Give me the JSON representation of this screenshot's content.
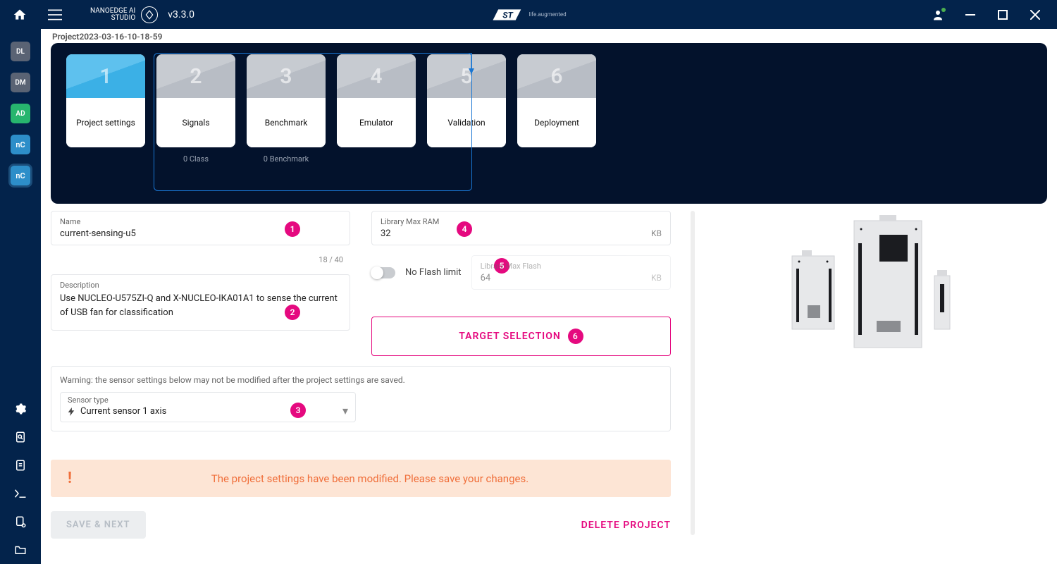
{
  "app": {
    "brand_top": "NANOEDGE AI",
    "brand_bot": "STUDIO",
    "version": "v3.3.0",
    "center_logo": "ST",
    "center_tag": "life.augmented"
  },
  "sidebar": {
    "items": [
      {
        "code": "DL"
      },
      {
        "code": "DM"
      },
      {
        "code": "AD"
      },
      {
        "code": "nC"
      },
      {
        "code": "nC"
      }
    ]
  },
  "project": {
    "name_header": "Project2023-03-16-10-18-59"
  },
  "steps": [
    {
      "num": "1",
      "label": "Project settings",
      "sub": "",
      "active": true
    },
    {
      "num": "2",
      "label": "Signals",
      "sub": "0 Class",
      "active": false
    },
    {
      "num": "3",
      "label": "Benchmark",
      "sub": "0 Benchmark",
      "active": false
    },
    {
      "num": "4",
      "label": "Emulator",
      "sub": "",
      "active": false
    },
    {
      "num": "5",
      "label": "Validation",
      "sub": "",
      "active": false
    },
    {
      "num": "6",
      "label": "Deployment",
      "sub": "",
      "active": false
    }
  ],
  "form": {
    "name_label": "Name",
    "name_value": "current-sensing-u5",
    "name_counter": "18 / 40",
    "desc_label": "Description",
    "desc_value": "Use NUCLEO-U575ZI-Q and X-NUCLEO-IKA01A1 to sense the current of USB fan for classification",
    "ram_label": "Library Max RAM",
    "ram_value": "32",
    "ram_unit": "KB",
    "flash_toggle_label": "No Flash limit",
    "flash_label": "Library Max Flash",
    "flash_value": "64",
    "flash_unit": "KB",
    "target_btn": "TARGET SELECTION",
    "sensor_warning": "Warning: the sensor settings below may not be modified after the project settings are saved.",
    "sensor_type_label": "Sensor type",
    "sensor_type_value": "Current sensor 1 axis"
  },
  "alert": {
    "text": "The project settings have been modified. Please save your changes."
  },
  "actions": {
    "save": "SAVE & NEXT",
    "delete": "DELETE PROJECT"
  },
  "badges": {
    "b1": "1",
    "b2": "2",
    "b3": "3",
    "b4": "4",
    "b5": "5",
    "b6": "6"
  },
  "colors": {
    "accent": "#e5097f",
    "header": "#03234b"
  }
}
